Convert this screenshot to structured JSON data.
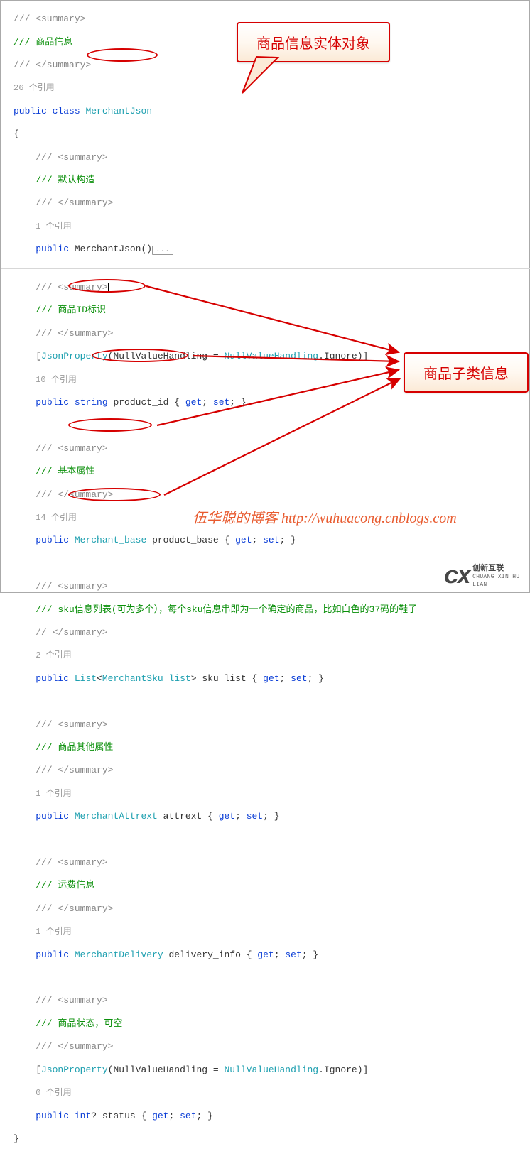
{
  "annotations": {
    "entityObject": "商品信息实体对象",
    "subclasses": "商品子类信息",
    "blogWatermark": "伍华聪的博客 http://wuhuacong.cnblogs.com",
    "logoBrand": "创新互联",
    "logoSub": "CHUANG XIN HU LIAN"
  },
  "code": {
    "summaryOpen": "/// <summary>",
    "summaryClose": "/// </summary>",
    "summaryCloseBroken": "// </summary>",
    "doc1": "/// 商品信息",
    "ref26": "26 个引用",
    "classDecl_public": "public",
    "classDecl_class": "class",
    "classDecl_name": "MerchantJson",
    "openBrace": "{",
    "closeBrace": "}",
    "docDefaultCtor": "/// 默认构造",
    "ref1": "1 个引用",
    "ctor_public": "public",
    "ctor_name": "MerchantJson",
    "ctor_paren": "()",
    "fold": "...",
    "docProductId": "/// 商品ID标识",
    "attrJsonProp_open": "[",
    "attrJsonProp_name": "JsonProperty",
    "attrJsonProp_args_open": "(NullValueHandling = ",
    "attrJsonProp_nvh": "NullValueHandling",
    "attrJsonProp_ign": ".Ignore)]",
    "ref10": "10 个引用",
    "pub": "public",
    "string": "string",
    "productId": " product_id { ",
    "get": "get",
    "set": "set",
    "accessor_sep": "; ",
    "accessor_close": "; }",
    "docBasic": "/// 基本属性",
    "ref14": "14 个引用",
    "merchantBase": "Merchant_base",
    "productBase": " product_base { ",
    "docSku": "/// sku信息列表(可为多个），每个sku信息串即为一个确定的商品，比如白色的37码的鞋子",
    "ref2": "2 个引用",
    "list": "List",
    "lt": "<",
    "gt": ">",
    "merchantSkuList": "MerchantSku_list",
    "skuList": " sku_list { ",
    "docOther": "/// 商品其他属性",
    "merchantAttrext": "MerchantAttrext",
    "attrext": " attrext { ",
    "docDelivery": "/// 运费信息",
    "merchantDelivery": "MerchantDelivery",
    "deliveryInfo": " delivery_info { ",
    "docStatus": "/// 商品状态，可空",
    "ref0": "0 个引用",
    "int": "int",
    "nullable": "?",
    "status": " status { "
  }
}
